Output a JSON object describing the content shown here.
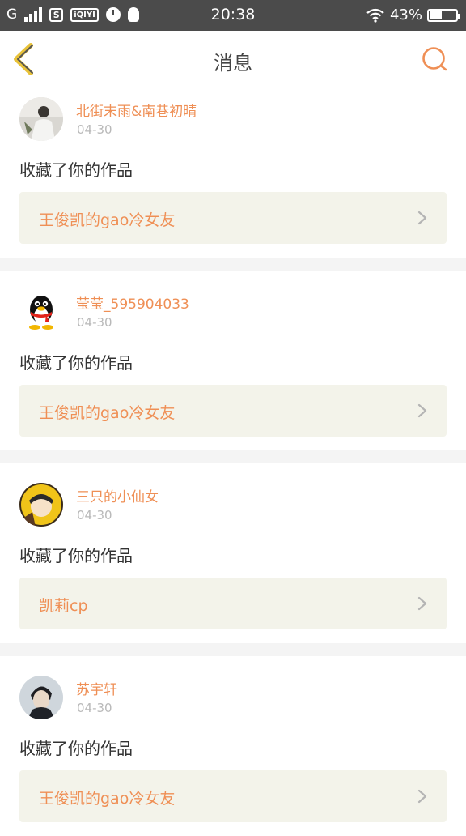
{
  "status_bar": {
    "network": "G",
    "time": "20:38",
    "battery": "43%",
    "battery_level": 0.43,
    "icons": [
      "signal-icon",
      "s-app-icon",
      "iqiyi-icon",
      "clock-icon",
      "qq-icon",
      "wifi-icon",
      "battery-icon"
    ]
  },
  "header": {
    "title": "消息",
    "back_icon": "chevron-left-icon",
    "search_icon": "search-icon",
    "accent": "#ef8f55",
    "back_color": "#e8c239"
  },
  "feed": [
    {
      "username": "北街末雨&南巷初晴",
      "date": "04-30",
      "action": "收藏了你的作品",
      "work_title": "王俊凯的gao冷女友",
      "avatar": "photo-avatar"
    },
    {
      "username": "莹莹_595904033",
      "date": "04-30",
      "action": "收藏了你的作品",
      "work_title": "王俊凯的gao冷女友",
      "avatar": "qq-penguin-avatar"
    },
    {
      "username": "三只的小仙女",
      "date": "04-30",
      "action": "收藏了你的作品",
      "work_title": "凯莉cp",
      "avatar": "photo-avatar"
    },
    {
      "username": "苏宇轩",
      "date": "04-30",
      "action": "收藏了你的作品",
      "work_title": "王俊凯的gao冷女友",
      "avatar": "photo-avatar"
    }
  ]
}
